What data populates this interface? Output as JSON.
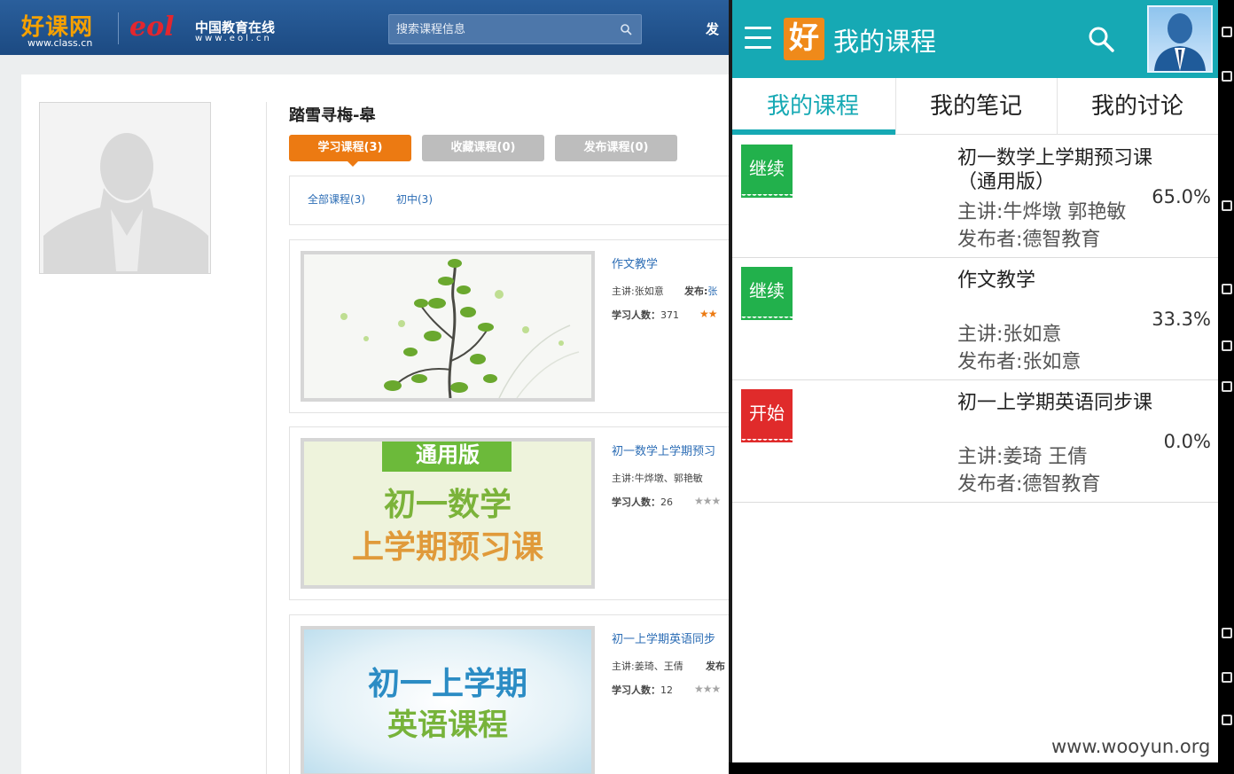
{
  "web": {
    "header": {
      "logo_hao": "好课网",
      "logo_hao_url": "www.class.cn",
      "logo_eol_mark": "eol",
      "logo_eol_name": "中国教育在线",
      "logo_eol_url": "www.eol.cn",
      "search_placeholder": "搜索课程信息",
      "publish_link": "发"
    },
    "profile": {
      "name": "踏雪寻梅-皋"
    },
    "tabs": [
      {
        "label": "学习课程(3)",
        "active": true
      },
      {
        "label": "收藏课程(0)",
        "active": false
      },
      {
        "label": "发布课程(0)",
        "active": false
      }
    ],
    "filters": [
      {
        "label": "全部课程(3)"
      },
      {
        "label": "初中(3)"
      }
    ],
    "courses": [
      {
        "title": "作文教学",
        "teacher": "主讲:张如意",
        "publisher_label": "发布:",
        "publisher_value": "张",
        "count_label": "学习人数：",
        "count": "371",
        "thumb_text": ""
      },
      {
        "title": "初一数学上学期预习",
        "teacher": "主讲:牛烨墩、郭艳敏",
        "publisher_label": "",
        "publisher_value": "",
        "count_label": "学习人数：",
        "count": "26",
        "thumb_banner": "通用版",
        "thumb_line1": "初一数学",
        "thumb_line2": "上学期预习课"
      },
      {
        "title": "初一上学期英语同步",
        "teacher": "主讲:姜琦、王倩",
        "publisher_label": "发布",
        "publisher_value": "",
        "count_label": "学习人数：",
        "count": "12",
        "thumb_line1": "初一上学期",
        "thumb_line2": "英语课程"
      }
    ]
  },
  "app": {
    "logo_char": "好",
    "title": "我的课程",
    "tabs": [
      {
        "label": "我的课程",
        "active": true
      },
      {
        "label": "我的笔记",
        "active": false
      },
      {
        "label": "我的讨论",
        "active": false
      }
    ],
    "rows": [
      {
        "badge": "继续",
        "badge_color": "#22b14c",
        "title": "初一数学上学期预习课（通用版）",
        "teacher": "主讲:牛烨墩 郭艳敏",
        "publisher": "发布者:德智教育",
        "progress": "65.0%"
      },
      {
        "badge": "继续",
        "badge_color": "#22b14c",
        "title": "作文教学",
        "teacher": "主讲:张如意",
        "publisher": "发布者:张如意",
        "progress": "33.3%"
      },
      {
        "badge": "开始",
        "badge_color": "#e02b2b",
        "title": "初一上学期英语同步课",
        "teacher": "主讲:姜琦 王倩",
        "publisher": "发布者:德智教育",
        "progress": "0.0%"
      }
    ]
  },
  "watermark": "www.wooyun.org",
  "colors": {
    "web_header": "#1c4a82",
    "web_tab_active": "#ec7a12",
    "app_accent": "#16a9b4",
    "badge_continue": "#22b14c",
    "badge_start": "#e02b2b"
  }
}
